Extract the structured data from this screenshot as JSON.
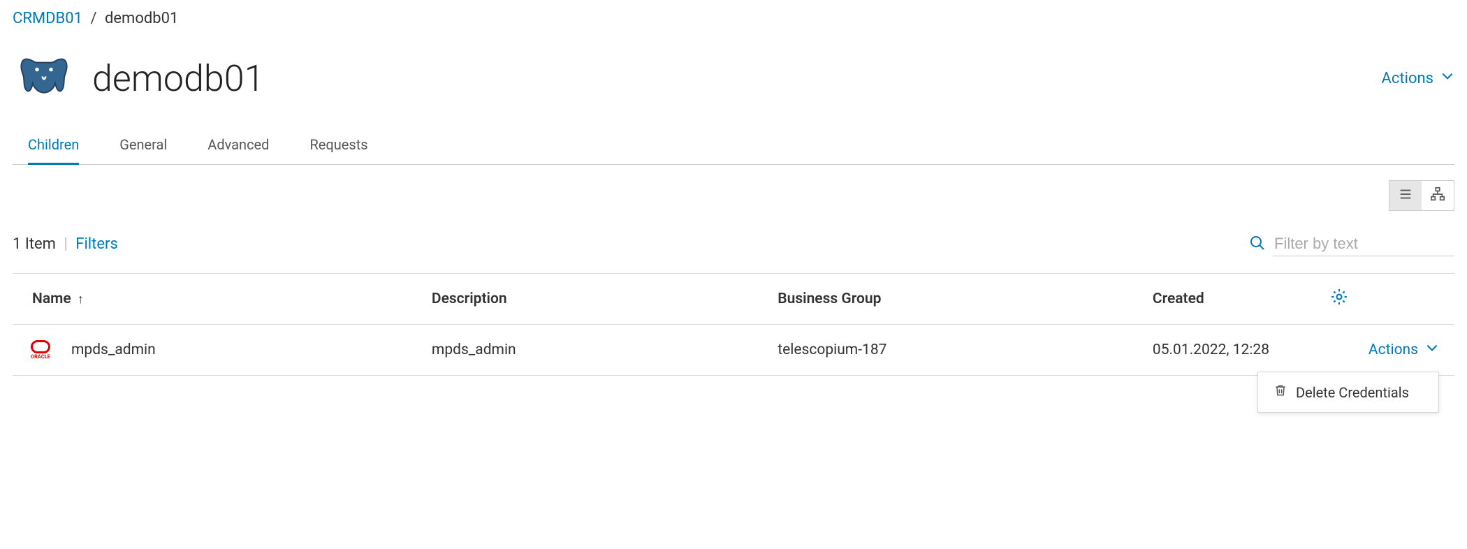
{
  "breadcrumb": {
    "parent": "CRMDB01",
    "current": "demodb01"
  },
  "header": {
    "title": "demodb01",
    "actions_label": "Actions"
  },
  "tabs": [
    {
      "label": "Children",
      "active": true
    },
    {
      "label": "General",
      "active": false
    },
    {
      "label": "Advanced",
      "active": false
    },
    {
      "label": "Requests",
      "active": false
    }
  ],
  "list": {
    "count_text": "1 Item",
    "filters_label": "Filters",
    "search_placeholder": "Filter by text"
  },
  "table": {
    "columns": {
      "name": "Name",
      "description": "Description",
      "business_group": "Business Group",
      "created": "Created"
    },
    "rows": [
      {
        "name": "mpds_admin",
        "description": "mpds_admin",
        "business_group": "telescopium-187",
        "created": "05.01.2022, 12:28",
        "actions_label": "Actions"
      }
    ]
  },
  "dropdown": {
    "delete_label": "Delete Credentials"
  }
}
